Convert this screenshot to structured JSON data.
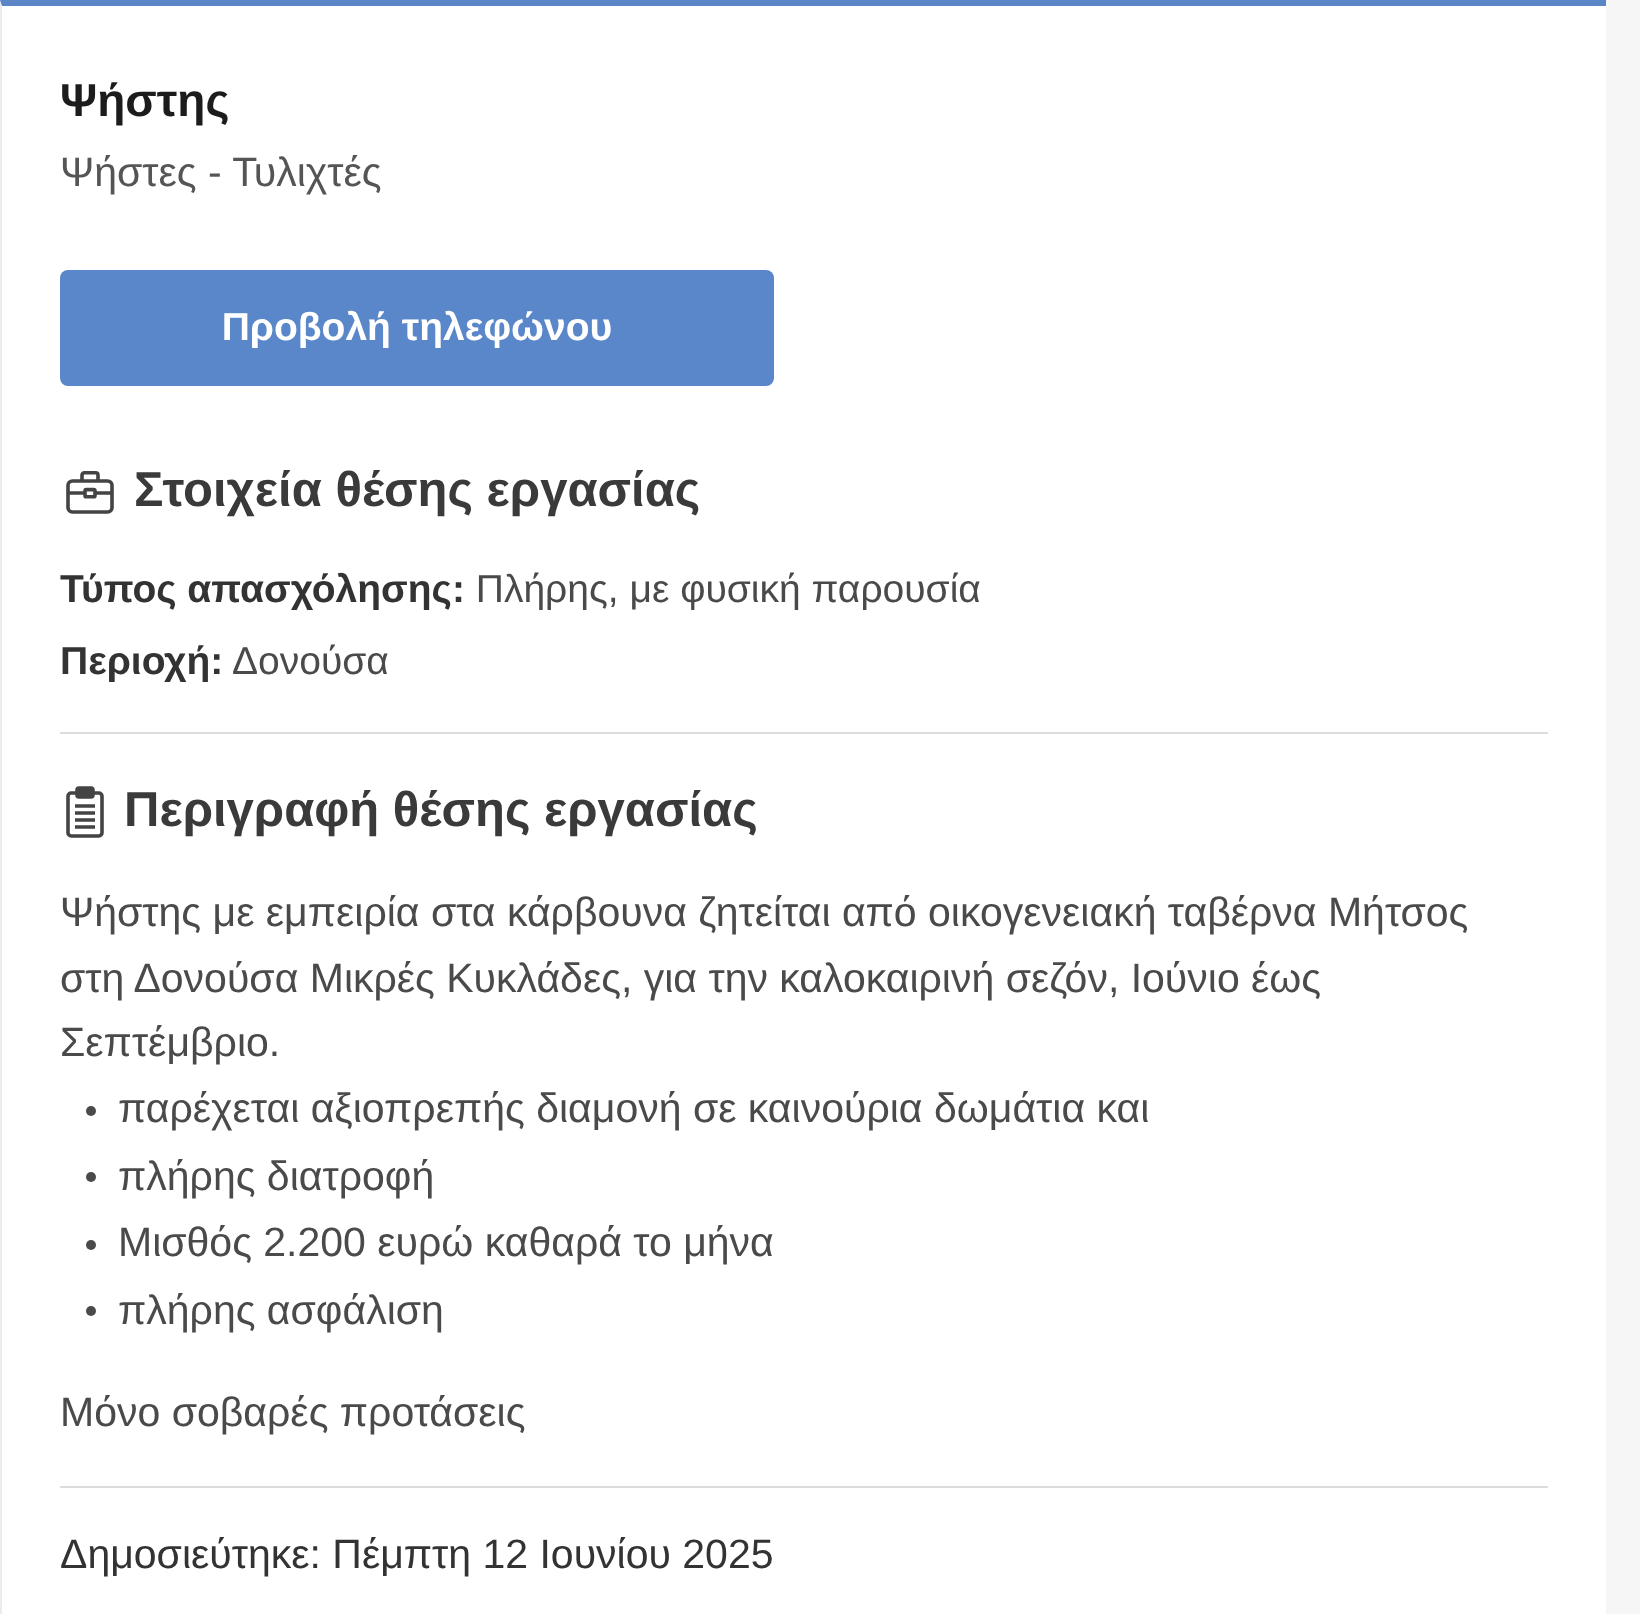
{
  "job": {
    "title": "Ψήστης",
    "category": "Ψήστες - Τυλιχτές"
  },
  "phone_button": {
    "label": "Προβολή τηλεφώνου"
  },
  "details": {
    "heading": "Στοιχεία θέσης εργασίας",
    "fields": [
      "**Τύπος απασχόλησης:** Πλήρης, με φυσική παρουσία",
      "**Περιοχή:** Δονούσα"
    ]
  },
  "description": {
    "heading": "Περιγραφή θέσης εργασίας",
    "paragraph": "Ψήστης με εμπειρία στα κάρβουνα ζητείται από οικογενειακή ταβέρνα Μήτσος στη Δονούσα Μικρές Κυκλάδες, για την καλοκαιρινή σεζόν, Ιούνιο έως\nΣεπτέμβριο.",
    "bullets": [
      "παρέχεται αξιοπρεπής διαμονή σε καινούρια δωμάτια και",
      "πλήρης διατροφή",
      "Μισθός 2.200 ευρώ καθαρά το μήνα",
      "πλήρης ασφάλιση"
    ],
    "note": "Μόνο σοβαρές προτάσεις"
  },
  "published": "Δημοσιεύτηκε: Πέμπτη 12 Ιουνίου 2025"
}
